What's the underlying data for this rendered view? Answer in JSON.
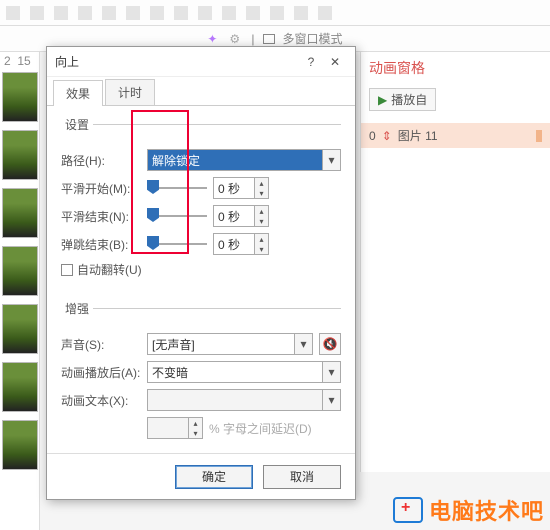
{
  "subbar": {
    "multiwindow": "多窗口模式"
  },
  "slidepane": {
    "nums": [
      "2",
      "15"
    ]
  },
  "animpane": {
    "title": "动画窗格",
    "play": "播放自",
    "item_index": "0",
    "item_label": "图片 11"
  },
  "dialog": {
    "title": "向上",
    "help": "?",
    "tabs": {
      "effect": "效果",
      "timing": "计时"
    },
    "group_settings": "设置",
    "path_label": "路径(H):",
    "path_value": "解除锁定",
    "smooth_start_label": "平滑开始(M):",
    "smooth_end_label": "平滑结束(N):",
    "bounce_end_label": "弹跳结束(B):",
    "zero_sec": "0 秒",
    "auto_reverse": "自动翻转(U)",
    "group_enhance": "增强",
    "sound_label": "声音(S):",
    "sound_value": "[无声音]",
    "after_label": "动画播放后(A):",
    "after_value": "不变暗",
    "text_label": "动画文本(X):",
    "delay_label": "% 字母之间延迟(D)",
    "ok": "确定",
    "cancel": "取消"
  },
  "watermark": {
    "text": "电脑技术吧"
  }
}
